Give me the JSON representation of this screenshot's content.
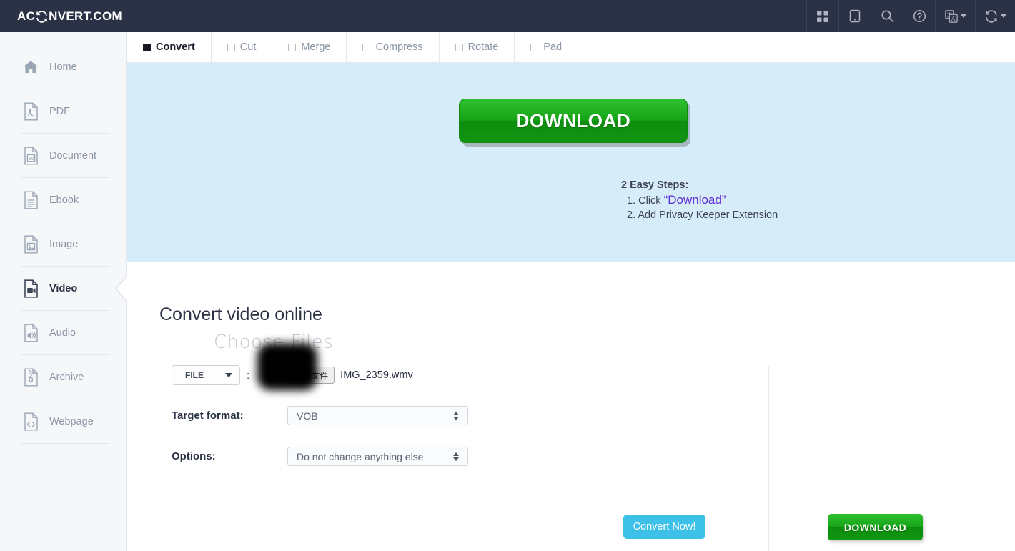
{
  "header": {
    "brand_prefix": "AC",
    "brand_suffix": "NVERT.COM",
    "brand_logo_icon": "refresh-cycle-icon",
    "icons": [
      {
        "name": "grid-apps-icon",
        "label": "Apps"
      },
      {
        "name": "tablet-device-icon",
        "label": "Device"
      },
      {
        "name": "search-icon",
        "label": "Search"
      },
      {
        "name": "help-circle-icon",
        "label": "Help"
      },
      {
        "name": "language-translate-icon",
        "label": "Language"
      },
      {
        "name": "convert-refresh-icon",
        "label": "Convert"
      }
    ]
  },
  "sidebar": {
    "items": [
      {
        "label": "Home",
        "icon": "home-icon",
        "active": false
      },
      {
        "label": "PDF",
        "icon": "pdf-file-icon",
        "active": false
      },
      {
        "label": "Document",
        "icon": "word-document-icon",
        "active": false
      },
      {
        "label": "Ebook",
        "icon": "ebook-file-icon",
        "active": false
      },
      {
        "label": "Image",
        "icon": "image-file-icon",
        "active": false
      },
      {
        "label": "Video",
        "icon": "video-file-icon",
        "active": true
      },
      {
        "label": "Audio",
        "icon": "audio-file-icon",
        "active": false
      },
      {
        "label": "Archive",
        "icon": "archive-zip-icon",
        "active": false
      },
      {
        "label": "Webpage",
        "icon": "webpage-code-icon",
        "active": false
      }
    ]
  },
  "tabs": [
    {
      "label": "Convert",
      "active": true
    },
    {
      "label": "Cut",
      "active": false
    },
    {
      "label": "Merge",
      "active": false
    },
    {
      "label": "Compress",
      "active": false
    },
    {
      "label": "Rotate",
      "active": false
    },
    {
      "label": "Pad",
      "active": false
    }
  ],
  "ad": {
    "download_label": "DOWNLOAD",
    "steps_heading": "2 Easy Steps:",
    "step1_prefix": "1. Click",
    "step1_emphasis": "“Download”",
    "step2": "2. Add Privacy Keeper Extension",
    "background_color": "#d6ecf8",
    "button_color": "#17a517",
    "emphasis_color": "#5c2bd6"
  },
  "main": {
    "page_title": "Convert video online",
    "choose_files_label": "Choose Files",
    "file_source_button": "FILE",
    "file_source_caret_icon": "chevron-down-icon",
    "file_separator": ":",
    "native_file_button": "选择文件",
    "selected_file_name": "IMG_2359.wmv",
    "target_format_label": "Target format:",
    "target_format_value": "VOB",
    "options_label": "Options:",
    "options_value": "Do not change anything else",
    "convert_button": "Convert Now!",
    "convert_button_color": "#3ec1e8",
    "bottom_download_button": "DOWNLOAD"
  }
}
